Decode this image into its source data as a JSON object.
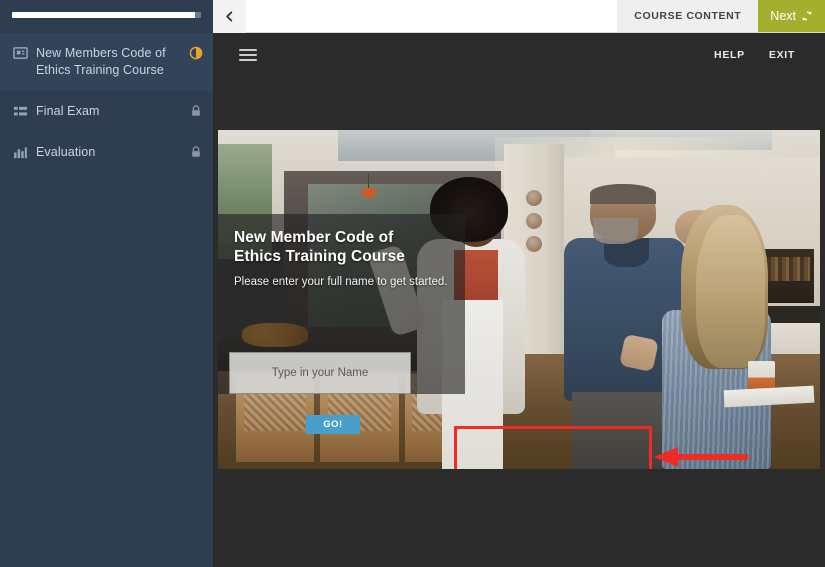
{
  "sidebar": {
    "progress": {
      "name": "course-progress",
      "percent": 97
    },
    "items": [
      {
        "label": "New Members Code of Ethics Training Course",
        "icon": "presentation-icon",
        "status_icon": "in-progress-icon",
        "active": true
      },
      {
        "label": "Final Exam",
        "icon": "list-icon",
        "status_icon": "lock-icon",
        "active": false
      },
      {
        "label": "Evaluation",
        "icon": "bar-chart-icon",
        "status_icon": "lock-icon",
        "active": false
      }
    ]
  },
  "lms_bar": {
    "back_icon": "chevron-left-icon",
    "course_content_label": "COURSE CONTENT",
    "next_label": "Next",
    "next_icon": "refresh-icon",
    "next_color": "#a3b02e"
  },
  "player_bar": {
    "menu_icon": "hamburger-menu-icon",
    "help_label": "HELP",
    "exit_label": "EXIT"
  },
  "slide": {
    "title": "New Member Code of Ethics Training Course",
    "subtitle": "Please enter your full name to get started.",
    "name_input": {
      "placeholder": "Type in your Name",
      "value": ""
    },
    "go_label": "GO!",
    "go_color": "#4a9ecb",
    "annotation_color": "#ee2b24"
  }
}
